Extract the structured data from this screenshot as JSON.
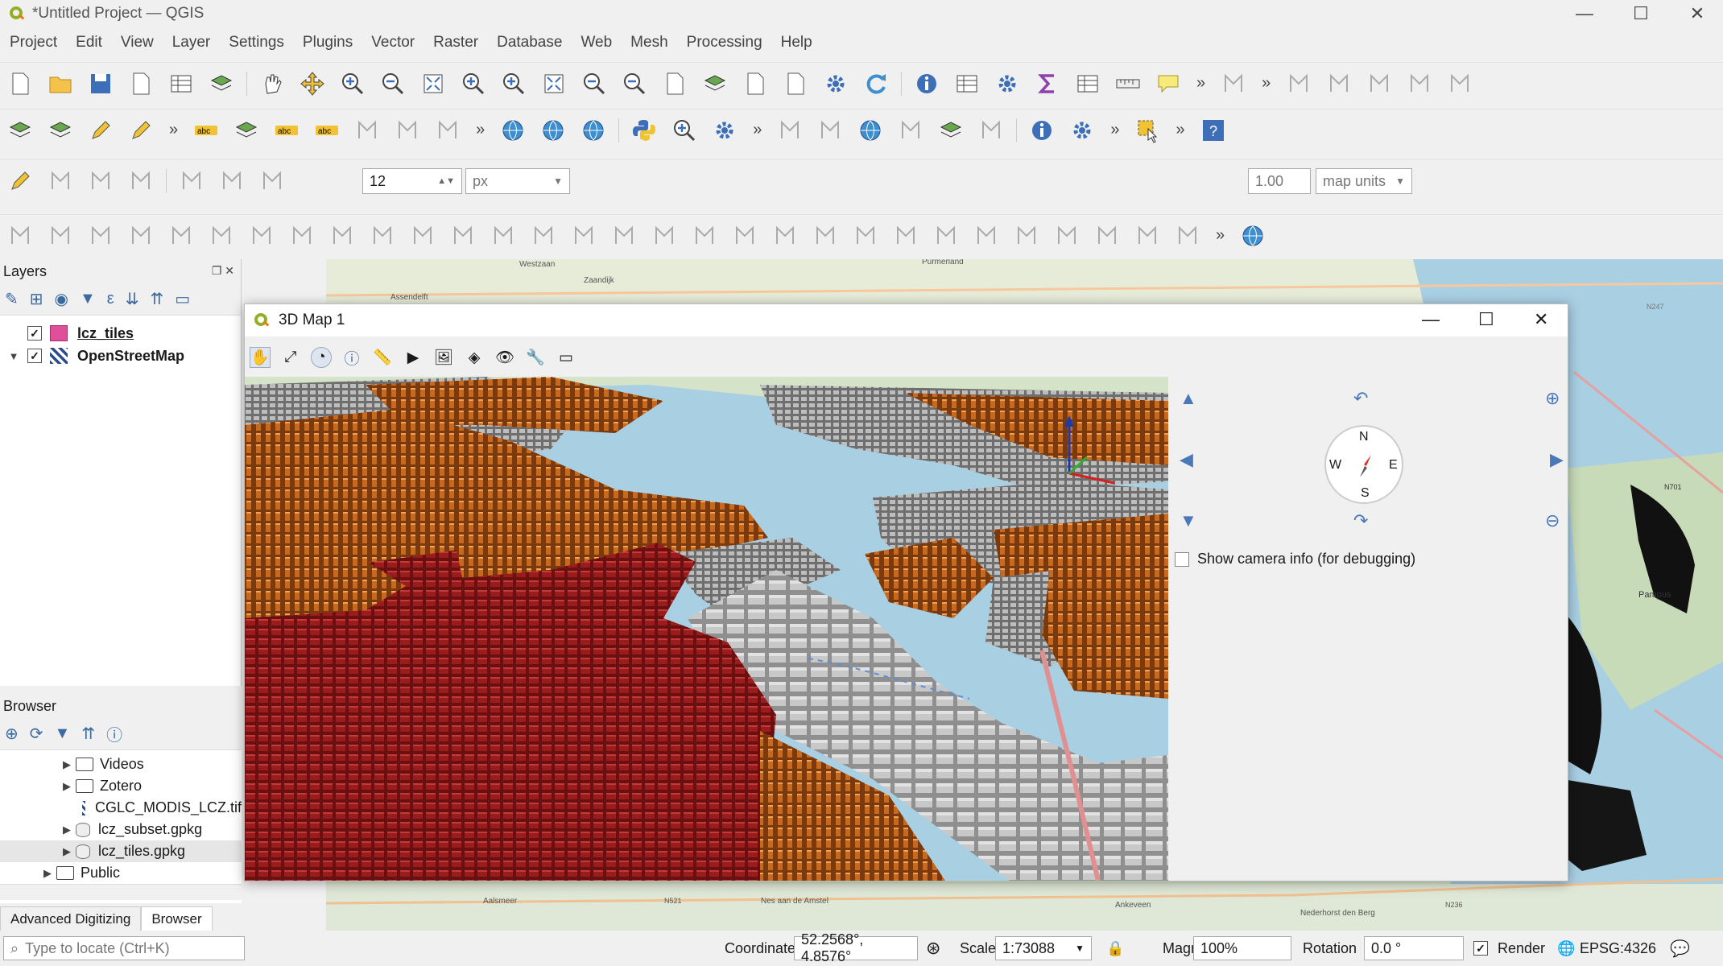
{
  "window": {
    "title": "*Untitled Project — QGIS"
  },
  "menu": [
    "Project",
    "Edit",
    "View",
    "Layer",
    "Settings",
    "Plugins",
    "Vector",
    "Raster",
    "Database",
    "Web",
    "Mesh",
    "Processing",
    "Help"
  ],
  "toolbar": {
    "font_size": "12",
    "font_unit": "px",
    "line_width": "1.00",
    "line_unit": "map units"
  },
  "layers_panel": {
    "title": "Layers",
    "items": [
      {
        "name": "lcz_tiles",
        "checked": true,
        "color": "#e0509a"
      },
      {
        "name": "OpenStreetMap",
        "checked": true
      }
    ]
  },
  "browser_panel": {
    "title": "Browser",
    "items": [
      {
        "label": "Videos",
        "kind": "folder"
      },
      {
        "label": "Zotero",
        "kind": "folder"
      },
      {
        "label": "CGLC_MODIS_LCZ.tif",
        "kind": "raster"
      },
      {
        "label": "lcz_subset.gpkg",
        "kind": "db"
      },
      {
        "label": "lcz_tiles.gpkg",
        "kind": "db"
      },
      {
        "label": "Public",
        "kind": "folder"
      }
    ]
  },
  "bottom_tabs": [
    "Advanced Digitizing",
    "Browser"
  ],
  "map3d": {
    "title": "3D Map 1",
    "compass": {
      "n": "N",
      "s": "S",
      "e": "E",
      "w": "W"
    },
    "camera_info_label": "Show camera info (for debugging)"
  },
  "statusbar": {
    "locate_placeholder": "Type to locate (Ctrl+K)",
    "coordinate_label": "Coordinate",
    "coordinate_value": "52.2568°, 4.8576°",
    "scale_label": "Scale",
    "scale_value": "1:73088",
    "magnifier_label": "Magnifier",
    "magnifier_value": "100%",
    "rotation_label": "Rotation",
    "rotation_value": "0.0 °",
    "render_label": "Render",
    "crs": "EPSG:4326"
  },
  "map_labels": [
    "Purmerland",
    "Zaandijk",
    "Westzaan",
    "Assendelft",
    "Pampus",
    "N701",
    "N247",
    "Nederhorst den Berg",
    "Aalsmeer",
    "Nes aan de Amstel",
    "Ankeveen",
    "N236",
    "N521"
  ],
  "colors": {
    "accent": "#4a78b8",
    "water": "#a9cfe3",
    "land": "#cfe3c4",
    "lcz_red": "#8c1a1a",
    "lcz_orange": "#c5641d",
    "lcz_gray": "#b5b5b5"
  }
}
